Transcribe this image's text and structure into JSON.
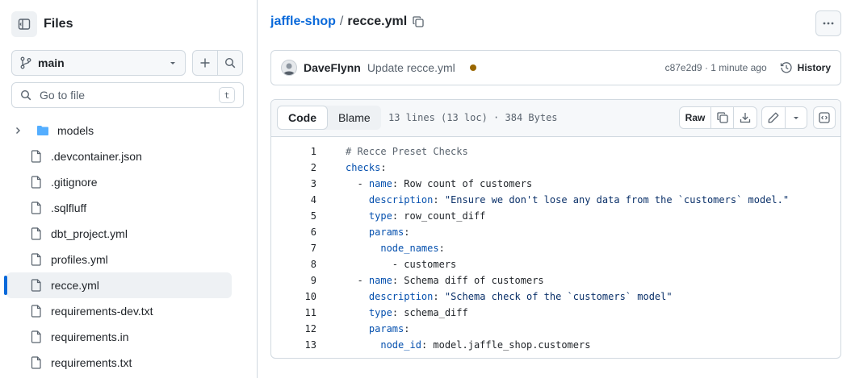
{
  "sidebar": {
    "title": "Files",
    "branch": "main",
    "goto_placeholder": "Go to file",
    "goto_shortcut": "t",
    "tree": [
      {
        "name": "models",
        "type": "folder"
      },
      {
        "name": ".devcontainer.json",
        "type": "file"
      },
      {
        "name": ".gitignore",
        "type": "file"
      },
      {
        "name": ".sqlfluff",
        "type": "file"
      },
      {
        "name": "dbt_project.yml",
        "type": "file"
      },
      {
        "name": "profiles.yml",
        "type": "file"
      },
      {
        "name": "recce.yml",
        "type": "file",
        "active": true
      },
      {
        "name": "requirements-dev.txt",
        "type": "file"
      },
      {
        "name": "requirements.in",
        "type": "file"
      },
      {
        "name": "requirements.txt",
        "type": "file"
      }
    ]
  },
  "breadcrumb": {
    "repo": "jaffle-shop",
    "separator": "/",
    "file": "recce.yml"
  },
  "commit": {
    "author": "DaveFlynn",
    "message": "Update recce.yml",
    "status_color": "#9a6700",
    "meta": "c87e2d9 · 1 minute ago",
    "history_label": "History"
  },
  "viewer": {
    "tabs": [
      "Code",
      "Blame"
    ],
    "active_tab": "Code",
    "file_info": "13 lines (13 loc) · 384 Bytes",
    "raw_label": "Raw"
  },
  "code_lines": [
    {
      "n": "1",
      "segs": [
        [
          "cm",
          "# Recce Preset Checks"
        ]
      ]
    },
    {
      "n": "2",
      "segs": [
        [
          "k",
          "checks"
        ],
        [
          "",
          ":"
        ]
      ]
    },
    {
      "n": "3",
      "segs": [
        [
          "",
          "  - "
        ],
        [
          "k",
          "name"
        ],
        [
          "",
          ": Row count of customers"
        ]
      ]
    },
    {
      "n": "4",
      "segs": [
        [
          "",
          "    "
        ],
        [
          "k",
          "description"
        ],
        [
          "",
          ": "
        ],
        [
          "str",
          "\"Ensure we don't lose any data from the `customers` model.\""
        ]
      ]
    },
    {
      "n": "5",
      "segs": [
        [
          "",
          "    "
        ],
        [
          "k",
          "type"
        ],
        [
          "",
          ": row_count_diff"
        ]
      ]
    },
    {
      "n": "6",
      "segs": [
        [
          "",
          "    "
        ],
        [
          "k",
          "params"
        ],
        [
          "",
          ":"
        ]
      ]
    },
    {
      "n": "7",
      "segs": [
        [
          "",
          "      "
        ],
        [
          "k",
          "node_names"
        ],
        [
          "",
          ":"
        ]
      ]
    },
    {
      "n": "8",
      "segs": [
        [
          "",
          "        - customers"
        ]
      ]
    },
    {
      "n": "9",
      "segs": [
        [
          "",
          "  - "
        ],
        [
          "k",
          "name"
        ],
        [
          "",
          ": Schema diff of customers"
        ]
      ]
    },
    {
      "n": "10",
      "segs": [
        [
          "",
          "    "
        ],
        [
          "k",
          "description"
        ],
        [
          "",
          ": "
        ],
        [
          "str",
          "\"Schema check of the `customers` model\""
        ]
      ]
    },
    {
      "n": "11",
      "segs": [
        [
          "",
          "    "
        ],
        [
          "k",
          "type"
        ],
        [
          "",
          ": schema_diff"
        ]
      ]
    },
    {
      "n": "12",
      "segs": [
        [
          "",
          "    "
        ],
        [
          "k",
          "params"
        ],
        [
          "",
          ":"
        ]
      ]
    },
    {
      "n": "13",
      "segs": [
        [
          "",
          "      "
        ],
        [
          "k",
          "node_id"
        ],
        [
          "",
          ": model.jaffle_shop.customers"
        ]
      ]
    }
  ]
}
